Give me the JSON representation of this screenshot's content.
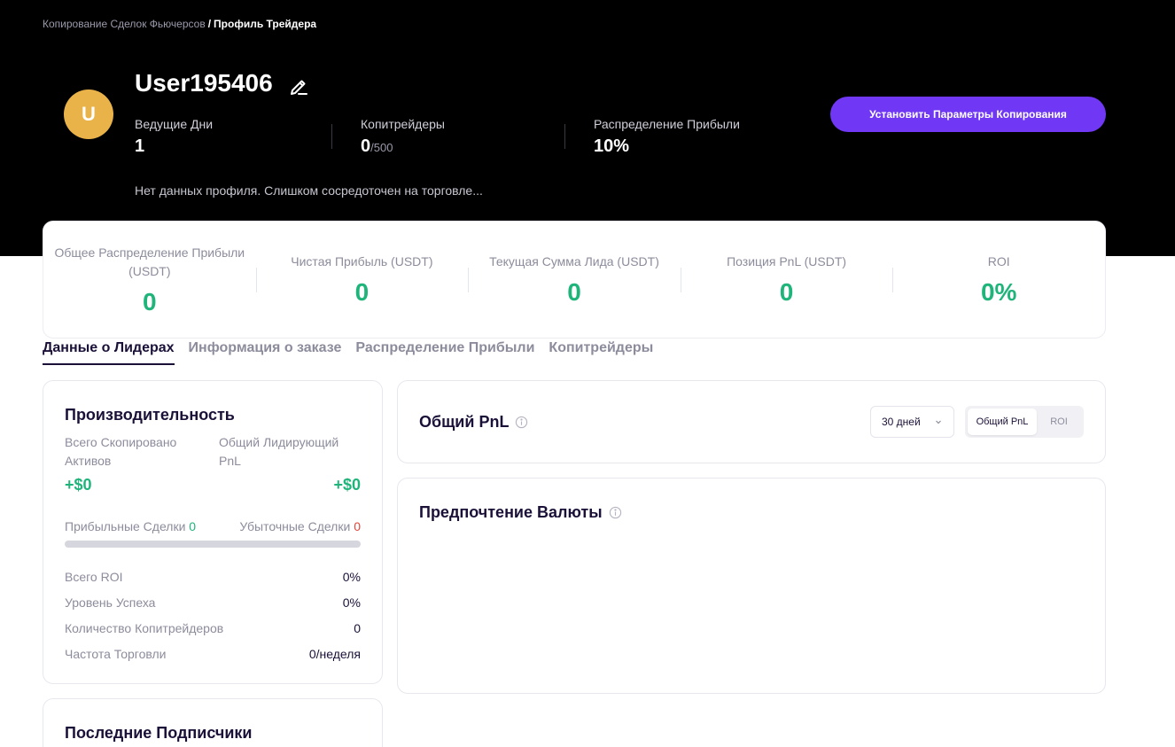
{
  "breadcrumb": {
    "parent": "Копирование Сделок Фьючерсов",
    "separator": "/",
    "current": "Профиль Трейдера"
  },
  "profile": {
    "avatar_letter": "U",
    "username": "User195406",
    "bio": "Нет данных профиля. Слишком сосредоточен на торговле...",
    "stats": {
      "lead_days_label": "Ведущие Дни",
      "lead_days": "1",
      "copytraders_label": "Копитрейдеры",
      "copytraders": "0",
      "copytraders_max": "/500",
      "profit_share_label": "Распределение Прибыли",
      "profit_share": "10%"
    },
    "copy_button": "Установить Параметры Копирования"
  },
  "summary": [
    {
      "label": "Общее Распределение Прибыли (USDT)",
      "value": "0"
    },
    {
      "label": "Чистая Прибыль (USDT)",
      "value": "0"
    },
    {
      "label": "Текущая Сумма Лида (USDT)",
      "value": "0"
    },
    {
      "label": "Позиция PnL (USDT)",
      "value": "0"
    },
    {
      "label": "ROI",
      "value": "0%"
    }
  ],
  "tabs": [
    "Данные о Лидерах",
    "Информация о заказе",
    "Распределение Прибыли",
    "Копитрейдеры"
  ],
  "performance": {
    "title": "Производительность",
    "total_copied_label": "Всего Скопировано Активов",
    "total_copied": "+$0",
    "lead_pnl_label": "Общий Лидирующий PnL",
    "lead_pnl": "+$0",
    "profit_trades_label": "Прибыльные Сделки",
    "profit_trades": "0",
    "loss_trades_label": "Убыточные Сделки",
    "loss_trades": "0",
    "rows": [
      {
        "label": "Всего ROI",
        "value": "0%"
      },
      {
        "label": "Уровень Успеха",
        "value": "0%"
      },
      {
        "label": "Количество Копитрейдеров",
        "value": "0"
      },
      {
        "label": "Частота Торговли",
        "value": "0/неделя"
      }
    ]
  },
  "subscribers": {
    "title": "Последние Подписчики"
  },
  "pnl_card": {
    "title": "Общий PnL",
    "period": "30 дней",
    "toggle": [
      "Общий PnL",
      "ROI"
    ]
  },
  "currency_card": {
    "title": "Предпочтение Валюты"
  },
  "colors": {
    "accent": "#7038f5",
    "positive": "#1fb47a",
    "negative": "#e2453c",
    "avatar": "#e9b34a"
  }
}
